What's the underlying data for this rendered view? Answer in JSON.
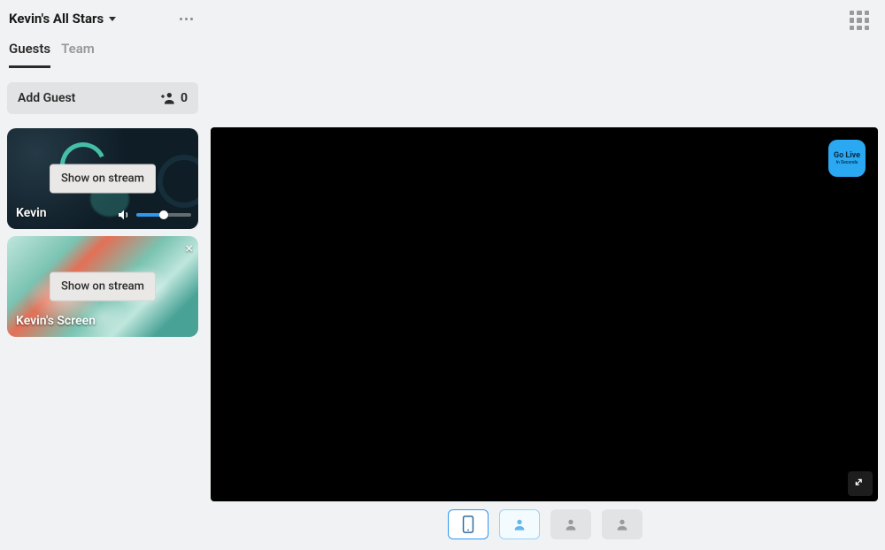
{
  "header": {
    "title": "Kevin's All Stars"
  },
  "tabs": {
    "guests": "Guests",
    "team": "Team",
    "active": "guests"
  },
  "addGuest": {
    "label": "Add Guest",
    "count": "0"
  },
  "tiles": {
    "kevin": {
      "name": "Kevin",
      "showLabel": "Show on stream"
    },
    "screen": {
      "name": "Kevin's Screen",
      "showLabel": "Show on stream"
    }
  },
  "golive": {
    "line1": "Go Live",
    "line2": "In Seconds"
  },
  "layout": {
    "options": [
      "single",
      "user-outline",
      "user-dim-1",
      "user-dim-2"
    ],
    "selected": "single"
  }
}
